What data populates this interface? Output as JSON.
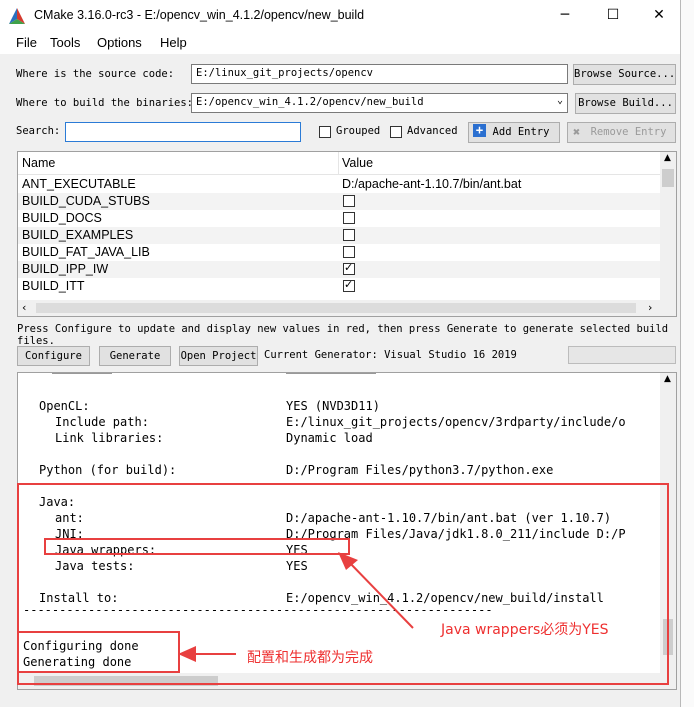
{
  "window": {
    "title": "CMake 3.16.0-rc3 - E:/opencv_win_4.1.2/opencv/new_build",
    "minimize": "─",
    "maximize": "☐",
    "close": "✕"
  },
  "menu": [
    {
      "label": "File"
    },
    {
      "label": "Tools"
    },
    {
      "label": "Options"
    },
    {
      "label": "Help"
    }
  ],
  "paths": {
    "source_label": "Where is the source code:",
    "source_value": "E:/linux_git_projects/opencv",
    "browse_source": "Browse Source...",
    "build_label": "Where to build the binaries:",
    "build_value": "E:/opencv_win_4.1.2/opencv/new_build",
    "browse_build": "Browse Build..."
  },
  "search": {
    "label": "Search:",
    "value": "",
    "grouped": "Grouped",
    "advanced": "Advanced",
    "add_entry": "Add Entry",
    "remove_entry": "Remove Entry"
  },
  "table": {
    "col_name": "Name",
    "col_value": "Value",
    "rows": [
      {
        "name": "ANT_EXECUTABLE",
        "value": "D:/apache-ant-1.10.7/bin/ant.bat"
      },
      {
        "name": "BUILD_CUDA_STUBS",
        "checked": false
      },
      {
        "name": "BUILD_DOCS",
        "checked": false
      },
      {
        "name": "BUILD_EXAMPLES",
        "checked": false
      },
      {
        "name": "BUILD_FAT_JAVA_LIB",
        "checked": false
      },
      {
        "name": "BUILD_IPP_IW",
        "checked": true
      },
      {
        "name": "BUILD_ITT",
        "checked": true
      }
    ]
  },
  "hint": "Press Configure to update and display new values in red, then press Generate to generate selected build files.",
  "actions": {
    "configure": "Configure",
    "generate": "Generate",
    "open_project": "Open Project",
    "current_generator": "Current Generator: Visual Studio 16 2019"
  },
  "output": {
    "lines": [
      {
        "key": "OpenCL:",
        "indent": 1,
        "val": "YES (NVD3D11)"
      },
      {
        "key": "Include path:",
        "indent": 2,
        "val": "E:/linux_git_projects/opencv/3rdparty/include/o"
      },
      {
        "key": "Link libraries:",
        "indent": 2,
        "val": "Dynamic load"
      },
      {
        "key": "Python (for build):",
        "indent": 1,
        "val": "D:/Program Files/python3.7/python.exe"
      },
      {
        "key": "Java:",
        "indent": 1,
        "val": ""
      },
      {
        "key": "ant:",
        "indent": 2,
        "val": "D:/apache-ant-1.10.7/bin/ant.bat (ver 1.10.7)"
      },
      {
        "key": "JNI:",
        "indent": 2,
        "val": "D:/Program Files/Java/jdk1.8.0_211/include D:/P"
      },
      {
        "key": "Java wrappers:",
        "indent": 2,
        "val": "YES"
      },
      {
        "key": "Java tests:",
        "indent": 2,
        "val": "YES"
      },
      {
        "key": "Install to:",
        "indent": 1,
        "val": "E:/opencv_win_4.1.2/opencv/new_build/install"
      }
    ],
    "separator": "-----------------------------------------------------------------",
    "configuring": "Configuring done",
    "generating": "Generating done"
  },
  "annotations": {
    "java_wrappers": "Java wrappers必须为YES",
    "done": "配置和生成都为完成"
  },
  "colors": {
    "annotation_red": "#e84040"
  }
}
